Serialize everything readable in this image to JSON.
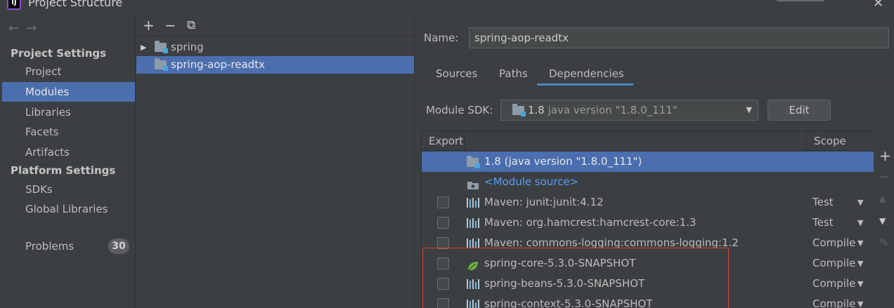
{
  "window": {
    "title": "Project Structure",
    "app_icon": "IJ"
  },
  "nav": {
    "back": "←",
    "forward": "→"
  },
  "sidebar": {
    "project_settings_header": "Project Settings",
    "project_items": [
      {
        "label": "Project"
      },
      {
        "label": "Modules",
        "selected": true
      },
      {
        "label": "Libraries"
      },
      {
        "label": "Facets"
      },
      {
        "label": "Artifacts"
      }
    ],
    "platform_settings_header": "Platform Settings",
    "platform_items": [
      {
        "label": "SDKs"
      },
      {
        "label": "Global Libraries"
      }
    ],
    "problems": {
      "label": "Problems",
      "count": "30"
    }
  },
  "tree_toolbar": {
    "add": "+",
    "remove": "−",
    "copy": "⧉"
  },
  "tree": [
    {
      "label": "spring",
      "expandable": true
    },
    {
      "label": "spring-aop-readtx",
      "selected": true
    }
  ],
  "details": {
    "name_label": "Name:",
    "name_value": "spring-aop-readtx",
    "tabs": [
      "Sources",
      "Paths",
      "Dependencies"
    ],
    "active_tab": "Dependencies",
    "sdk_label": "Module SDK:",
    "sdk_value": "1.8",
    "sdk_version": "java version \"1.8.0_111\"",
    "edit_label": "Edit"
  },
  "dependencies": {
    "columns": {
      "export": "Export",
      "scope": "Scope"
    },
    "rows": [
      {
        "label": "1.8 (java version \"1.8.0_111\")",
        "icon": "jdk-folder-icon",
        "scope": "",
        "checkbox": false,
        "selected": true
      },
      {
        "label": "<Module source>",
        "icon": "module-source-icon",
        "scope": "",
        "checkbox": false,
        "link": true
      },
      {
        "label": "Maven: junit:junit:4.12",
        "icon": "library-icon",
        "scope": "Test",
        "checkbox": true
      },
      {
        "label": "Maven: org.hamcrest:hamcrest-core:1.3",
        "icon": "library-icon",
        "scope": "Test",
        "checkbox": true
      },
      {
        "label": "Maven: commons-logging:commons-logging:1.2",
        "icon": "library-icon",
        "scope": "Compile",
        "checkbox": true
      },
      {
        "label": "spring-core-5.3.0-SNAPSHOT",
        "icon": "spring-leaf-icon",
        "scope": "Compile",
        "checkbox": true
      },
      {
        "label": "spring-beans-5.3.0-SNAPSHOT",
        "icon": "library-icon",
        "scope": "Compile",
        "checkbox": true
      },
      {
        "label": "spring-context-5.3.0-SNAPSHOT",
        "icon": "library-icon",
        "scope": "Compile",
        "checkbox": true
      }
    ]
  },
  "side_tools": {
    "add": "+",
    "remove": "−",
    "up": "▲",
    "down": "▼",
    "edit": "✎"
  },
  "colors": {
    "selection": "#4b6eaf",
    "link": "#589df6",
    "highlight_box": "#d7453f",
    "background": "#3c3f41"
  }
}
